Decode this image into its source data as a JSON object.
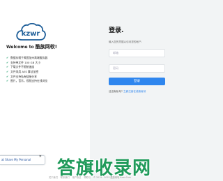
{
  "brand": {
    "logo_text": "kzwr",
    "welcome": "Welcome to ",
    "welcome_brand": "酷族网软!"
  },
  "features": [
    "数据存储于美国加州高端服务器",
    "支持单文件 100 GB 大小",
    "下载文件不限制速度",
    "文件采用 AES 算法加密",
    "文件支持私有链接分享",
    "图片，音乐，视频支持在线浏览"
  ],
  "share_widget": {
    "text": "at Share My Personal",
    "close": "×"
  },
  "login": {
    "title": "登录.",
    "subtitle": "输入您的凭据以访问您的帐户.",
    "email_placeholder": "邮箱",
    "password_placeholder": "密码",
    "button": "登录",
    "no_account": "还没有帐号? ",
    "register_link": "立即注册在线新帐号"
  },
  "footer": {
    "links": [
      "关于我们",
      "联系我们",
      "用户协议",
      "帮助与",
      "© 2015 - 2025 酷族网软 Kzwr.Com"
    ]
  },
  "watermark": "答旗收录网",
  "colors": {
    "accent": "#2f86ee",
    "check": "#22a06b",
    "watermark": "#1f9a5a"
  }
}
